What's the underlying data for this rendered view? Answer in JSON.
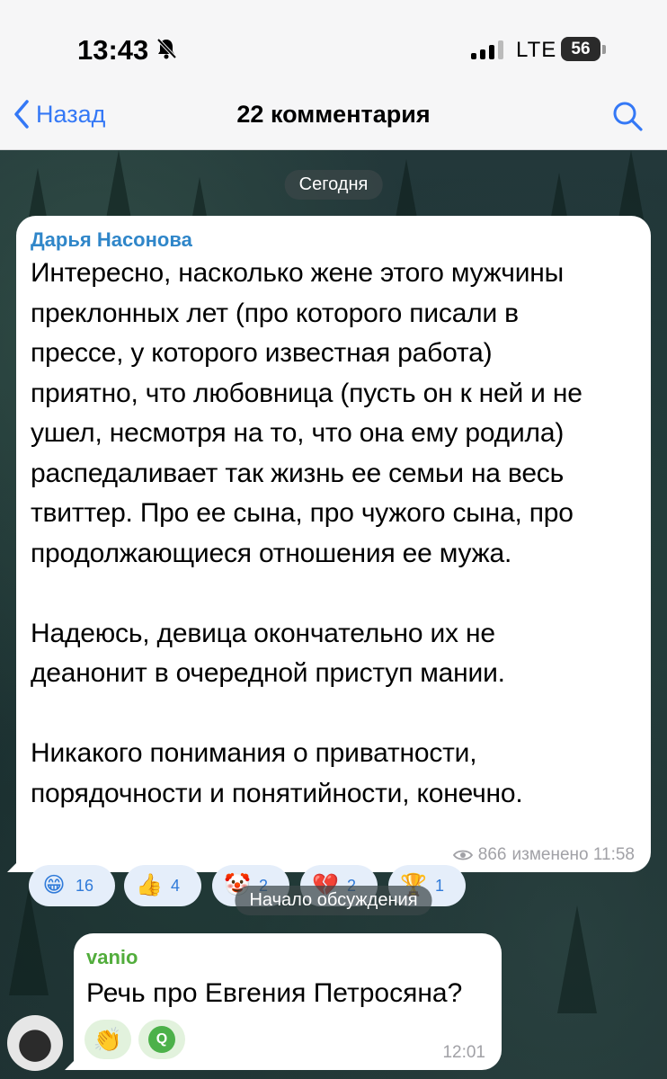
{
  "status_bar": {
    "time": "13:43",
    "network": "LTE",
    "battery": "56"
  },
  "nav": {
    "back_label": "Назад",
    "title": "22 комментария"
  },
  "chat": {
    "date_label": "Сегодня",
    "main_message": {
      "author": "Дарья Насонова",
      "text": "Интересно, насколько жене этого мужчины\nпреклонных лет (про которого писали в\nпрессе, у которого известная работа)\nприятно, что любовница (пусть он к ней и не\nушел, несмотря на то, что она ему родила)\nраспедаливает так жизнь ее семьи на весь\nтвиттер. Про ее сына, про чужого сына, про\nпродолжающиеся отношения ее мужа.\n\nНадеюсь, девица окончательно их не\nдеанонит в очередной приступ мании.\n\nНикакого понимания о приватности,\nпорядочности и понятийности, конечно.",
      "reactions": [
        {
          "icon": "grinning-face-icon",
          "glyph": "😁",
          "count": "16"
        },
        {
          "icon": "thumbs-up-icon",
          "glyph": "👍",
          "count": "4"
        },
        {
          "icon": "clown-face-icon",
          "glyph": "🤡",
          "count": "2"
        },
        {
          "icon": "broken-heart-icon",
          "glyph": "💔",
          "count": "2"
        },
        {
          "icon": "trophy-icon",
          "glyph": "🏆",
          "count": "1"
        }
      ],
      "views": "866",
      "edited_time": "изменено 11:58"
    },
    "discussion_label": "Начало обсуждения",
    "reply": {
      "author": "vanio",
      "text": "Речь про Евгения Петросяна?",
      "reactions": [
        {
          "icon": "clapping-hands-icon",
          "glyph": "👏"
        },
        {
          "icon": "reactor-avatar-icon",
          "glyph": "Q"
        }
      ],
      "time": "12:01"
    }
  }
}
